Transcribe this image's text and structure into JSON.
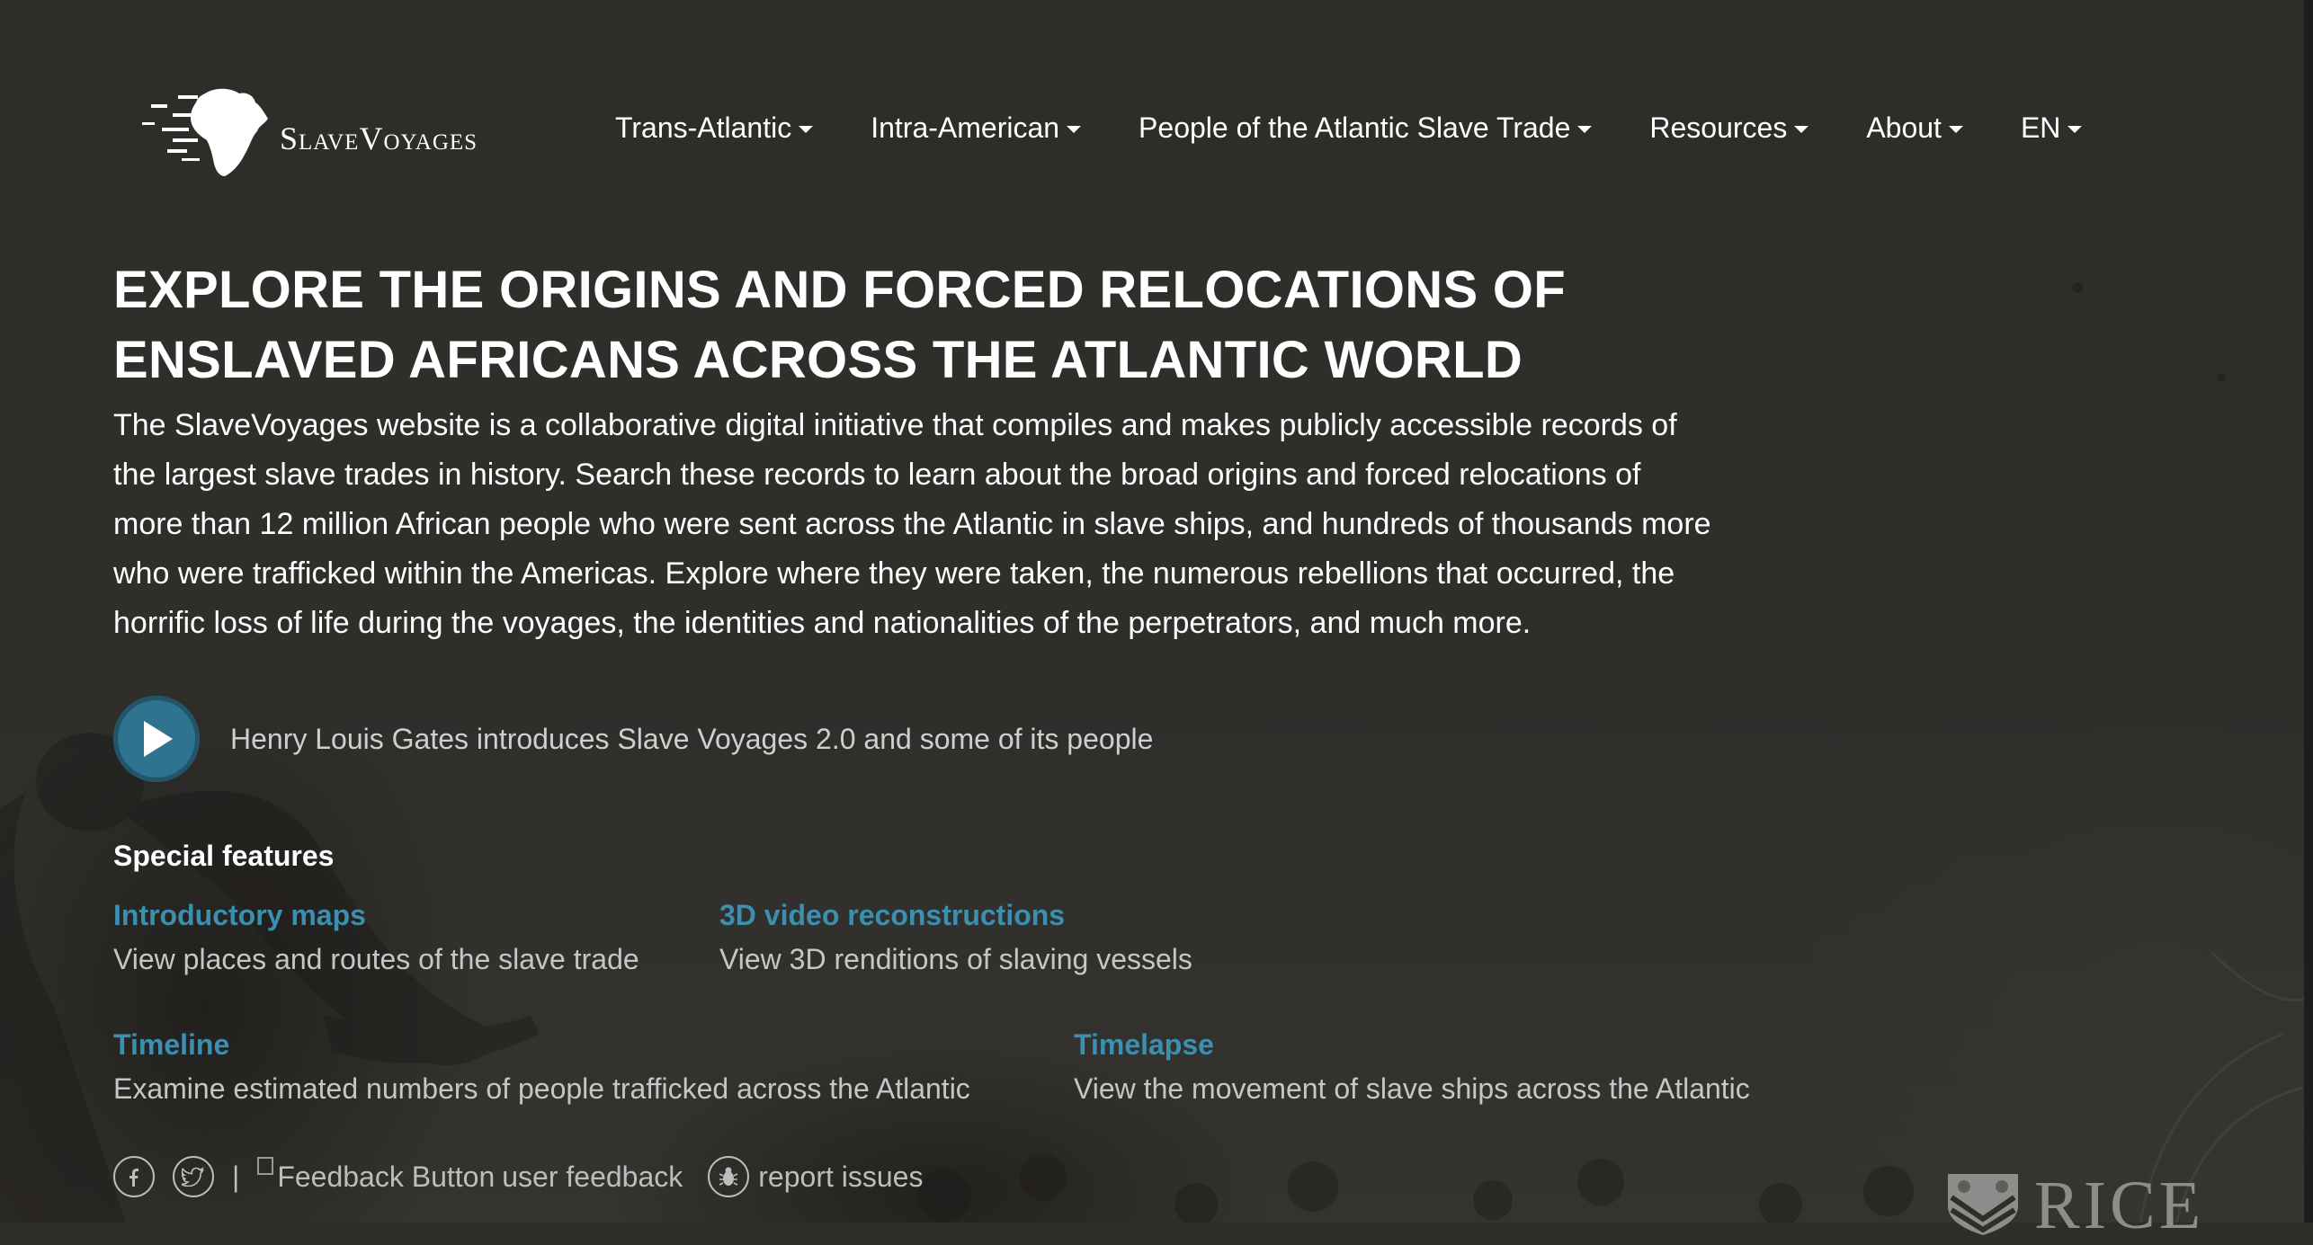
{
  "brand": {
    "name": "SlaveVoyages",
    "partner": "RICE"
  },
  "nav": {
    "items": [
      {
        "label": "Trans-Atlantic"
      },
      {
        "label": "Intra-American"
      },
      {
        "label": "People of the Atlantic Slave Trade"
      },
      {
        "label": "Resources"
      },
      {
        "label": "About"
      },
      {
        "label": "EN"
      }
    ]
  },
  "hero": {
    "title_line1": "EXPLORE THE ORIGINS AND FORCED RELOCATIONS OF",
    "title_line2": "ENSLAVED AFRICANS ACROSS THE ATLANTIC WORLD",
    "body_lines": [
      "The SlaveVoyages website is a collaborative digital initiative that compiles and makes publicly accessible records of",
      "the largest slave trades in history. Search these records to learn about the broad origins and forced relocations of",
      "more than 12 million African people who were sent across the Atlantic in slave ships, and hundreds of thousands more",
      "who were trafficked within the Americas. Explore where they were taken, the numerous rebellions that occurred, the",
      "horrific loss of life during the voyages, the identities and nationalities of the perpetrators, and much more."
    ]
  },
  "video": {
    "label": "Henry Louis Gates introduces Slave Voyages 2.0 and some of its people",
    "icon": "play-icon"
  },
  "features": {
    "heading": "Special features",
    "items": [
      {
        "title": "Introductory maps",
        "desc": "View places and routes of the slave trade"
      },
      {
        "title": "3D video reconstructions",
        "desc": "View 3D renditions of slaving vessels"
      },
      {
        "title": "Timeline",
        "desc": "Examine estimated numbers of people trafficked across the Atlantic"
      },
      {
        "title": "Timelapse",
        "desc": "View the movement of slave ships across the Atlantic"
      }
    ]
  },
  "footer": {
    "separator": "|",
    "feedback_img_alt": "Feedback Button",
    "feedback_label": "user feedback",
    "report_label": "report issues",
    "facebook_icon": "facebook-icon",
    "twitter_icon": "twitter-icon",
    "bug_icon": "bug-icon"
  },
  "colors": {
    "background": "#2f2e2b",
    "link": "#3d8fb0",
    "play_button": "#2e7490",
    "muted_text": "#c6c6c6"
  }
}
